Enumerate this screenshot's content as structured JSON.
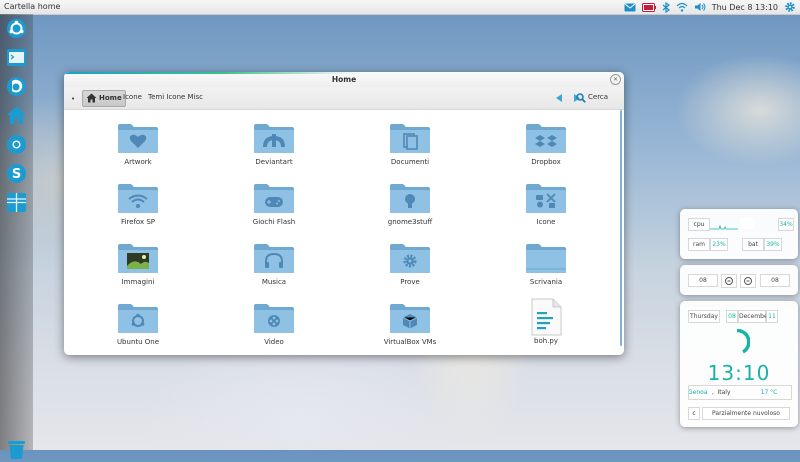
{
  "panel": {
    "title": "Cartella home",
    "clock": "Thu Dec  8 13:10",
    "tray_icons": [
      "mail-icon",
      "battery-icon",
      "bluetooth-icon",
      "wifi-icon",
      "volume-icon",
      "settings-gear-icon"
    ]
  },
  "dock": {
    "items": [
      "ubuntu-icon",
      "terminal-icon",
      "firefox-icon",
      "home-folder-icon",
      "chrome-icon",
      "skype-icon",
      "workspaces-icon",
      "trash-icon"
    ]
  },
  "window": {
    "title": "Home",
    "breadcrumbs": [
      "Home",
      "Icone",
      "Temi Icone Misc"
    ],
    "search_label": "Cerca",
    "items": [
      {
        "label": "Artwork",
        "icon": "heart-folder-icon"
      },
      {
        "label": "Deviantart",
        "icon": "deviantart-folder-icon"
      },
      {
        "label": "Documenti",
        "icon": "documents-folder-icon"
      },
      {
        "label": "Dropbox",
        "icon": "dropbox-folder-icon"
      },
      {
        "label": "Firefox SP",
        "icon": "wifi-folder-icon"
      },
      {
        "label": "Giochi Flash",
        "icon": "gamepad-folder-icon"
      },
      {
        "label": "gnome3stuff",
        "icon": "bulb-folder-icon"
      },
      {
        "label": "Icone",
        "icon": "icons-folder-icon"
      },
      {
        "label": "Immagini",
        "icon": "pictures-folder-icon"
      },
      {
        "label": "Musica",
        "icon": "headphones-folder-icon"
      },
      {
        "label": "Prove",
        "icon": "gear-folder-icon"
      },
      {
        "label": "Scrivania",
        "icon": "desktop-folder-icon"
      },
      {
        "label": "Ubuntu One",
        "icon": "ubuntu-one-folder-icon"
      },
      {
        "label": "Video",
        "icon": "film-folder-icon"
      },
      {
        "label": "VirtualBox VMs",
        "icon": "virtualbox-folder-icon"
      },
      {
        "label": "boh.py",
        "icon": "text-file-icon"
      }
    ]
  },
  "sysmon": {
    "cpu_label": "cpu",
    "cpu_value": "34%",
    "ram_label": "ram",
    "ram_value": "23%",
    "bat_label": "bat",
    "bat_value": "39%"
  },
  "volume_widget": {
    "left": "08",
    "right": "08"
  },
  "clock_widget": {
    "weekday": "Thursday",
    "day": "08",
    "month": "December",
    "month_num": "11",
    "time": "13:10",
    "city": "Genoa",
    "country": "Italy",
    "temperature": "17 °C",
    "weather_icon": "c",
    "weather": "Parzialmente nuvoloso",
    "accent": "#17b3a6"
  }
}
